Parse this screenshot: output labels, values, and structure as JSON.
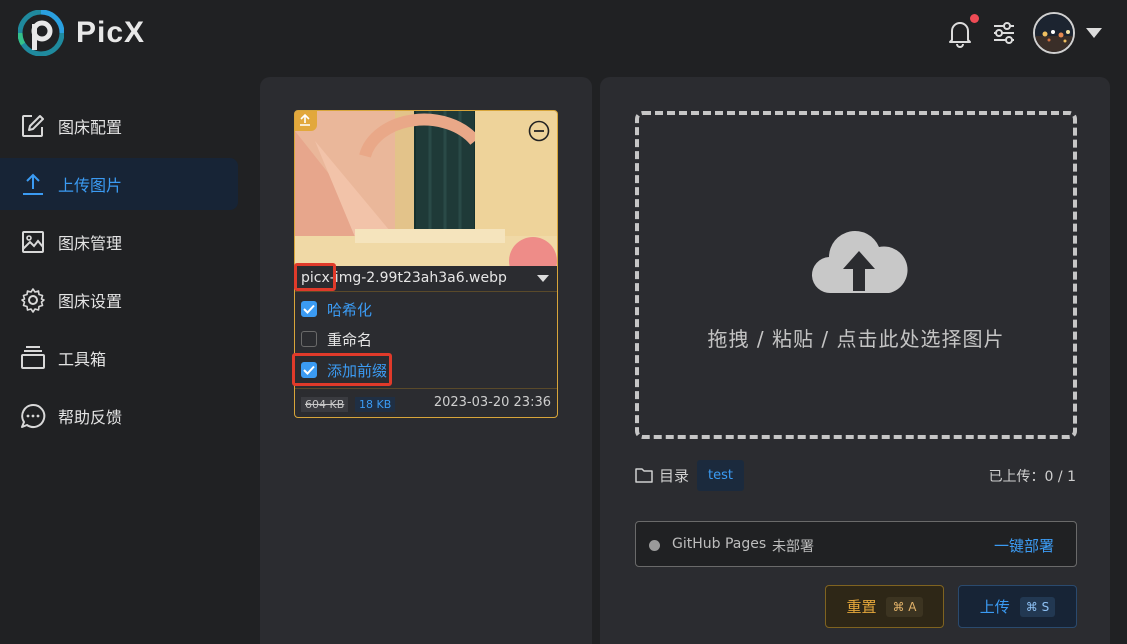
{
  "app": {
    "name": "PicX"
  },
  "header": {
    "notification_icon": "bell-icon",
    "settings_icon": "sliders-icon",
    "avatar": "user-avatar",
    "menu_icon": "caret-down-icon"
  },
  "sidebar": {
    "items": [
      {
        "label": "图床配置",
        "icon": "edit-icon",
        "active": false
      },
      {
        "label": "上传图片",
        "icon": "upload-icon",
        "active": true
      },
      {
        "label": "图床管理",
        "icon": "image-icon",
        "active": false
      },
      {
        "label": "图床设置",
        "icon": "gear-icon",
        "active": false
      },
      {
        "label": "工具箱",
        "icon": "toolbox-icon",
        "active": false
      },
      {
        "label": "帮助反馈",
        "icon": "chat-icon",
        "active": false
      }
    ]
  },
  "image_card": {
    "file_name": "picx-img-2.99t23ah3a6.webp",
    "options": [
      {
        "label": "哈希化",
        "checked": true
      },
      {
        "label": "重命名",
        "checked": false
      },
      {
        "label": "添加前缀",
        "checked": true
      }
    ],
    "original_size": "604 KB",
    "compressed_size": "18 KB",
    "date": "2023-03-20 23:36"
  },
  "dropzone": {
    "text": "拖拽 / 粘贴 / 点击此处选择图片"
  },
  "directory": {
    "label": "目录",
    "value": "test"
  },
  "upload_status": "已上传：0 / 1",
  "deploy": {
    "name": "GitHub Pages",
    "status": "未部署",
    "action": "一键部署"
  },
  "buttons": {
    "reset": {
      "label": "重置",
      "shortcut": "⌘ A"
    },
    "upload": {
      "label": "上传",
      "shortcut": "⌘ S"
    }
  },
  "colors": {
    "accent": "#3b9bf3",
    "warning": "#e3a63b",
    "highlight": "#e03a2a"
  }
}
